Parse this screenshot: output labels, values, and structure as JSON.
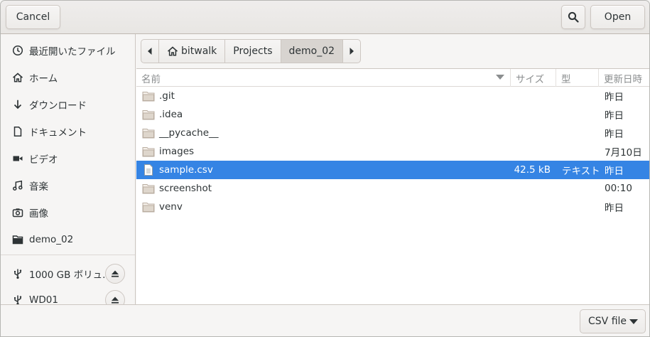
{
  "header": {
    "cancel_label": "Cancel",
    "open_label": "Open",
    "search_icon": "search-icon"
  },
  "sidebar": {
    "places": [
      {
        "label": "最近開いたファイル",
        "icon": "clock-icon"
      },
      {
        "label": "ホーム",
        "icon": "home-icon"
      },
      {
        "label": "ダウンロード",
        "icon": "download-icon"
      },
      {
        "label": "ドキュメント",
        "icon": "document-icon"
      },
      {
        "label": "ビデオ",
        "icon": "video-icon"
      },
      {
        "label": "音楽",
        "icon": "music-icon"
      },
      {
        "label": "画像",
        "icon": "camera-icon"
      },
      {
        "label": "demo_02",
        "icon": "folder-icon"
      }
    ],
    "devices": [
      {
        "label": "1000 GB ボリュ...",
        "icon": "usb-icon"
      },
      {
        "label": "WD01",
        "icon": "usb-icon"
      }
    ]
  },
  "pathbar": {
    "segments": [
      "bitwalk",
      "Projects",
      "demo_02"
    ],
    "active_index": 2
  },
  "columns": {
    "name": "名前",
    "size": "サイズ",
    "type": "型",
    "modified": "更新日時"
  },
  "files": [
    {
      "name": ".git",
      "kind": "folder",
      "size": "",
      "type": "",
      "modified": "昨日"
    },
    {
      "name": ".idea",
      "kind": "folder",
      "size": "",
      "type": "",
      "modified": "昨日"
    },
    {
      "name": "__pycache__",
      "kind": "folder",
      "size": "",
      "type": "",
      "modified": "昨日"
    },
    {
      "name": "images",
      "kind": "folder",
      "size": "",
      "type": "",
      "modified": "7月10日"
    },
    {
      "name": "sample.csv",
      "kind": "file",
      "size": "42.5 kB",
      "type": "テキスト",
      "modified": "昨日",
      "selected": true
    },
    {
      "name": "screenshot",
      "kind": "folder",
      "size": "",
      "type": "",
      "modified": "00:10"
    },
    {
      "name": "venv",
      "kind": "folder",
      "size": "",
      "type": "",
      "modified": "昨日"
    }
  ],
  "footer": {
    "filter_label": "CSV file"
  },
  "colors": {
    "selection": "#3584e4",
    "folder": "#d6cbc0"
  }
}
